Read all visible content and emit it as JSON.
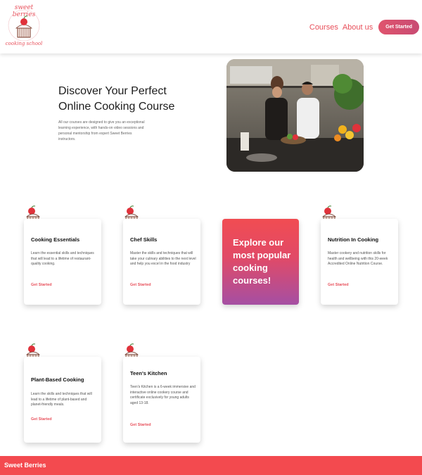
{
  "brand": {
    "logo_top": "sweet berries",
    "logo_bottom": "cooking school"
  },
  "nav": {
    "courses": "Courses",
    "about": "About us",
    "cta": "Get Started"
  },
  "hero": {
    "title_line1": "Discover Your Perfect",
    "title_line2": "Online Cooking Course",
    "description": "All our courses are designed to give you an exceptional learning experience, with hands-on video sessions and personal mentorship from expert Sweet Berries instructors."
  },
  "cards": [
    {
      "title": "Cooking Essentials",
      "description": "Learn the essential skills and techniques that will lead to a lifetime of restaurant-quality cooking.",
      "link": "Get Started"
    },
    {
      "title": "Chef Skills",
      "description": "Master the skills and techniques that will take your culinary abilities to the next level and help you excel in the food industry",
      "link": "Get Started"
    },
    {
      "title": "Nutrition In Cooking",
      "description": "Master cookery and nutrition skills for health and wellbeing with this 20-week Accredited Online Nutrition Course.",
      "link": "Get Started"
    },
    {
      "title": "Plant-Based Cooking",
      "description": "Learn the skills and techniques that will lead to a lifetime of plant-based and planet-friendly meals.",
      "link": "Get Started"
    },
    {
      "title": "Teen's Kitchen",
      "description": "Teen's Kitchen is a 6-week immersive and interactive online cookery course and certificate exclusively for young adults aged 13-18.",
      "link": "Get Started"
    }
  ],
  "promo": {
    "text": "Explore our most popular cooking courses!"
  },
  "footer": {
    "title": "Sweet Berries"
  },
  "colors": {
    "accent": "#e8505b",
    "footer": "#f34a4f",
    "promo_top": "#f14c52",
    "promo_bottom": "#a54fa3"
  }
}
